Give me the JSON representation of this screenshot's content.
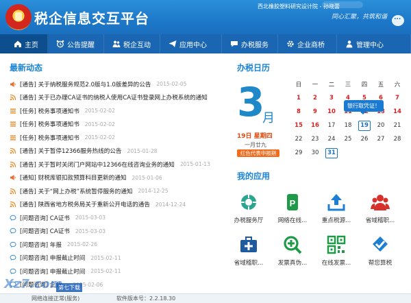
{
  "header": {
    "app_title": "税企信息交互平台",
    "org_user": "西北橡胶塑料研究设计院 - 孙晓蕾",
    "slogan": "同心汇聚，共筑和谐"
  },
  "nav": [
    {
      "label": "主页",
      "icon": "home-icon"
    },
    {
      "label": "公告提醒",
      "icon": "alarm-clock-icon"
    },
    {
      "label": "税企互动",
      "icon": "people-icon"
    },
    {
      "label": "应用中心",
      "icon": "paper-plane-icon"
    },
    {
      "label": "办税服务",
      "icon": "chat-bubble-icon"
    },
    {
      "label": "企业商桥",
      "icon": "gear-icon"
    },
    {
      "label": "管理中心",
      "icon": "person-icon"
    }
  ],
  "news": {
    "title": "最新动态",
    "items": [
      {
        "type": "announce",
        "text": "[通告] 关于纳税服务规范2.0版与1.0版差异的公告",
        "date": "2015-02-05"
      },
      {
        "type": "rss",
        "text": "[通告] 关于已办理CA证书的纳税人使用CA证书登录网上办税系统的通知",
        "date": ""
      },
      {
        "type": "task",
        "text": "[任务] 税务事项通知书",
        "date": "2015-02-02"
      },
      {
        "type": "task",
        "text": "[任务] 税务事项通知书",
        "date": "2015-02-02"
      },
      {
        "type": "task",
        "text": "[任务] 税务事项通知书",
        "date": "2015-02-02"
      },
      {
        "type": "rss",
        "text": "[通告] 关于暂停12366服务热线的公告",
        "date": "2015-01-28"
      },
      {
        "type": "rss",
        "text": "[通告] 关于暂时关闭门户网站中12366在线咨询业务的通知",
        "date": "2015-01-13"
      },
      {
        "type": "announce",
        "text": "[通知] 财税库银扣款预算科目更新的通知",
        "date": "2015-01-06"
      },
      {
        "type": "rss",
        "text": "[通告] 关于“网上办税”系统暂停服务的通知",
        "date": "2014-12-25"
      },
      {
        "type": "rss",
        "text": "[通告] 陕西省地方税务局关于重新公开电话的通告",
        "date": "2014-12-24"
      },
      {
        "type": "chat",
        "text": "[问题咨询] CA证书",
        "date": "2015-03-03"
      },
      {
        "type": "chat",
        "text": "[问题咨询] CA证书",
        "date": "2015-03-03"
      },
      {
        "type": "chat",
        "text": "[问题咨询] 年报",
        "date": "2015-02-26"
      },
      {
        "type": "chat",
        "text": "[问题咨询] 申报截止时间",
        "date": "2015-02-11"
      },
      {
        "type": "chat",
        "text": "[问题咨询] 申报截止时间",
        "date": "2015-02-11"
      },
      {
        "type": "chat",
        "text": "[问题咨询] 企业...",
        "date": "2015-02-06"
      }
    ]
  },
  "calendar": {
    "title": "办税日历",
    "month_number": "3",
    "month_suffix": "月",
    "day_line": "19日  星期四",
    "lunar": "一月廿九",
    "legend": "红色代表申报期",
    "tooltip": "银行取凭证！",
    "weekdays": [
      "日",
      "一",
      "二",
      "三",
      "四",
      "五",
      "六"
    ],
    "rows": [
      [
        {
          "d": "1",
          "r": true
        },
        {
          "d": "2",
          "r": true
        },
        {
          "d": "3",
          "r": true
        },
        {
          "d": "4",
          "r": true
        },
        {
          "d": "5",
          "r": true
        },
        {
          "d": "6",
          "r": true
        },
        {
          "d": "7",
          "r": true
        }
      ],
      [
        {
          "d": "8",
          "r": true
        },
        {
          "d": "9",
          "r": true
        },
        {
          "d": "10",
          "r": true
        },
        {
          "d": "11",
          "r": true
        },
        {
          "d": "12",
          "r": true
        },
        {
          "d": "13",
          "r": true
        },
        {
          "d": "14",
          "r": true
        }
      ],
      [
        {
          "d": "15",
          "r": true
        },
        {
          "d": "16",
          "r": true
        },
        {
          "d": "17",
          "r": false
        },
        {
          "d": "18",
          "r": false
        },
        {
          "d": "19",
          "r": false,
          "today": true
        },
        {
          "d": "20",
          "r": false
        },
        {
          "d": "21",
          "r": false
        }
      ],
      [
        {
          "d": "22",
          "r": false
        },
        {
          "d": "23",
          "r": false
        },
        {
          "d": "24",
          "r": false
        },
        {
          "d": "25",
          "r": false
        },
        {
          "d": "26",
          "r": false
        },
        {
          "d": "27",
          "r": false
        },
        {
          "d": "28",
          "r": false
        }
      ],
      [
        {
          "d": "29",
          "r": false
        },
        {
          "d": "30",
          "r": false
        },
        {
          "d": "31",
          "r": false,
          "today": true
        }
      ]
    ]
  },
  "apps": {
    "title": "我的应用",
    "items": [
      {
        "label": "办税服务厅",
        "icon": "service-hall-icon",
        "color": "#2aa58f"
      },
      {
        "label": "网络在线...",
        "icon": "online-icon",
        "color": "#1e9a48"
      },
      {
        "label": "重点税源...",
        "icon": "upload-icon",
        "color": "#1c7fd1"
      },
      {
        "label": "省域稽职...",
        "icon": "group-icon",
        "color": "#d6322b"
      },
      {
        "label": "省域稽职...",
        "icon": "first-aid-icon",
        "color": "#1e5a9e"
      },
      {
        "label": "发票真伪...",
        "icon": "magnifier-icon",
        "color": "#1e9a48"
      },
      {
        "label": "在线发票...",
        "icon": "qr-code-icon",
        "color": "#1e9a48"
      },
      {
        "label": "帮您算税",
        "icon": "check-icon",
        "color": "#1c7fd1"
      }
    ]
  },
  "footer": {
    "status": "网络连接正常(服务)",
    "version": "软件版本号：2.2.18.30",
    "watermark": "Xz7.com",
    "watermark_sub": "第七下载"
  }
}
